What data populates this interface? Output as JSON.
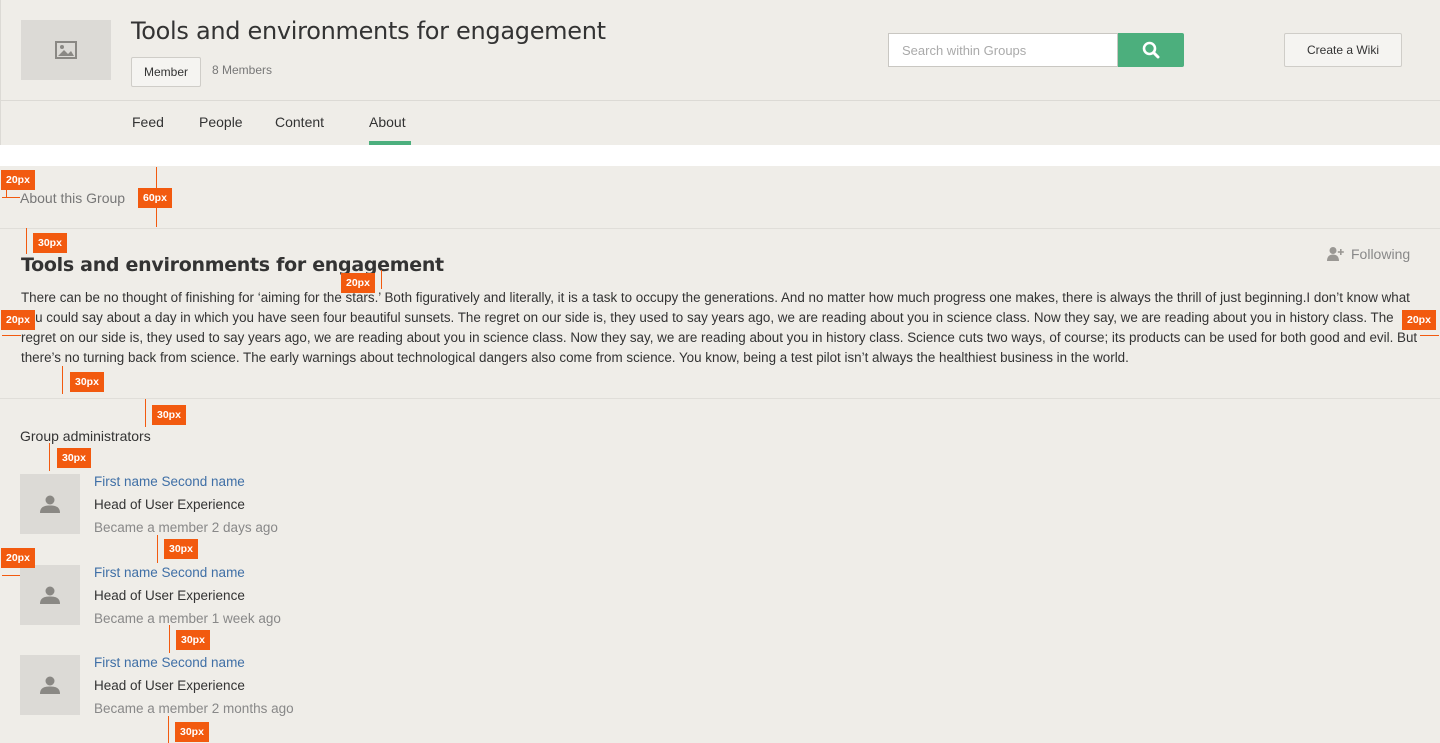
{
  "header": {
    "title": "Tools and environments for engagement",
    "member_label": "Member",
    "member_count": "8 Members",
    "search_placeholder": "Search within Groups",
    "create_wiki_label": "Create a Wiki",
    "image_icon": "image-icon",
    "search_icon": "search-icon"
  },
  "tabs": [
    {
      "label": "Feed"
    },
    {
      "label": "People"
    },
    {
      "label": "Content"
    },
    {
      "label": "About",
      "active": true
    }
  ],
  "about": {
    "section_label": "About this Group",
    "title": "Tools and environments for engagement",
    "following_label": "Following",
    "following_icon": "add-user-icon",
    "description": "There can be no thought of finishing for ‘aiming for the stars.’ Both figuratively and literally, it is a task to occupy the generations. And no matter how much progress one makes, there is always the thrill of just beginning.I don’t know what you could say about a day in which you have seen four beautiful sunsets. The regret on our side is, they used to say years ago, we are reading about you in science class. Now they say, we are reading about you in history class. The regret on our side is, they used to say years ago, we are reading about you in science class. Now they say, we are reading about you in history class. Science cuts two ways, of course; its products can be used for both good and evil. But there’s no turning back from science. The early warnings about technological dangers also come from science. You know, being a test pilot isn’t always the healthiest business in the world."
  },
  "admins": {
    "title": "Group administrators",
    "items": [
      {
        "name": "First name Second name",
        "role": "Head of User Experience",
        "since": "Became a member 2 days ago"
      },
      {
        "name": "First name Second name",
        "role": "Head of User Experience",
        "since": "Became a member 1 week ago"
      },
      {
        "name": "First name Second name",
        "role": "Head of User Experience",
        "since": "Became a member 2 months ago"
      }
    ]
  },
  "redlines": [
    "20px",
    "60px",
    "30px",
    "20px",
    "20px",
    "20px",
    "30px",
    "30px",
    "30px",
    "30px",
    "20px",
    "30px",
    "30px"
  ],
  "colors": {
    "accent": "#4caf7d",
    "link": "#3f6fa6",
    "redline": "#f25a0f",
    "background": "#efede8"
  }
}
